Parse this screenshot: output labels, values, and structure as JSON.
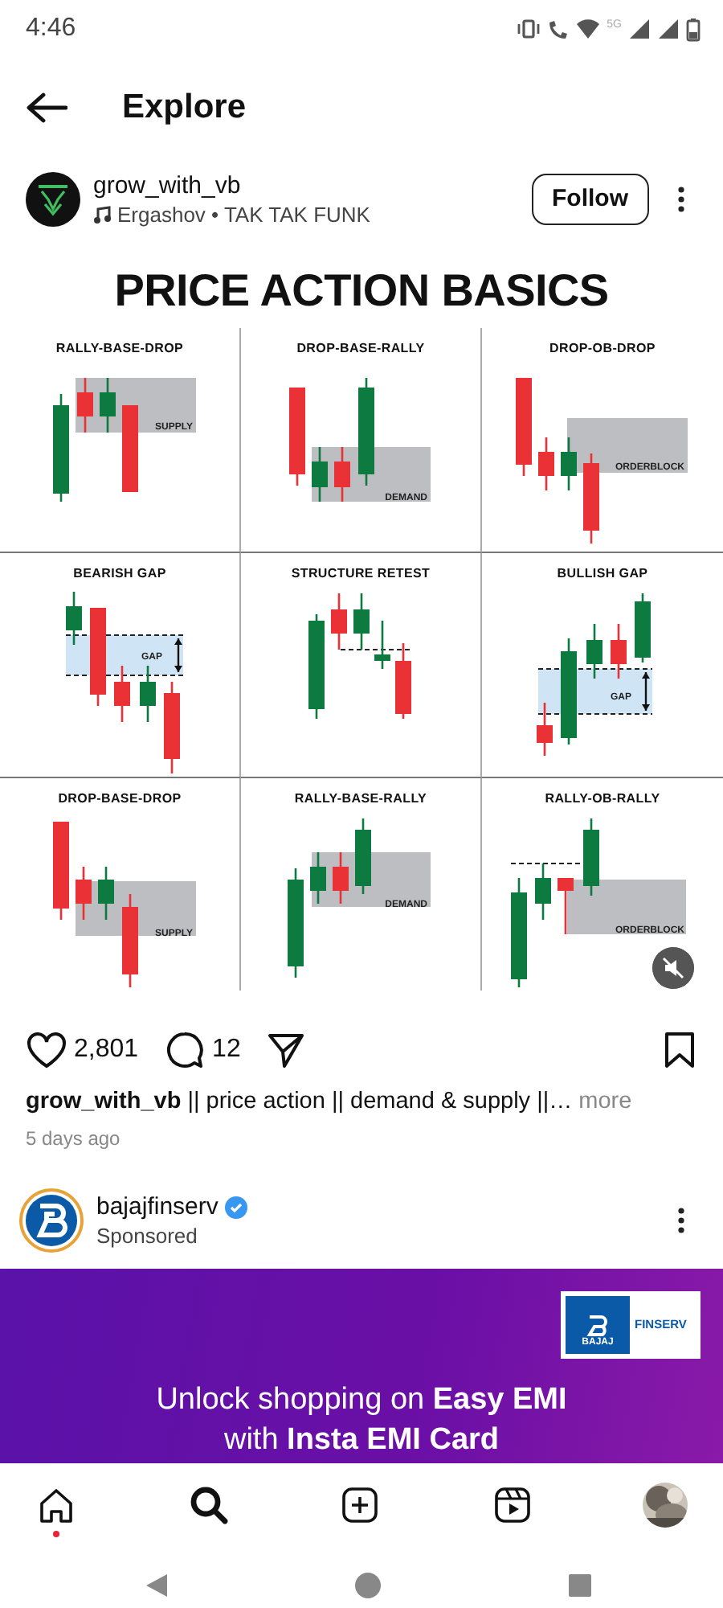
{
  "status_bar": {
    "time": "4:46",
    "network_label": "5G"
  },
  "header": {
    "title": "Explore"
  },
  "post": {
    "username": "grow_with_vb",
    "audio": "Ergashov • TAK TAK FUNK",
    "follow_label": "Follow",
    "image": {
      "title": "PRICE ACTION BASICS",
      "panels": [
        {
          "title": "RALLY-BASE-DROP",
          "zone_label": "SUPPLY"
        },
        {
          "title": "DROP-BASE-RALLY",
          "zone_label": "DEMAND"
        },
        {
          "title": "DROP-OB-DROP",
          "zone_label": "ORDERBLOCK"
        },
        {
          "title": "BEARISH GAP",
          "zone_label": "GAP"
        },
        {
          "title": "STRUCTURE RETEST"
        },
        {
          "title": "BULLISH GAP",
          "zone_label": "GAP"
        },
        {
          "title": "DROP-BASE-DROP",
          "zone_label": "SUPPLY"
        },
        {
          "title": "RALLY-BASE-RALLY",
          "zone_label": "DEMAND"
        },
        {
          "title": "RALLY-OB-RALLY",
          "zone_label": "ORDERBLOCK"
        }
      ]
    },
    "muted": true,
    "likes": "2,801",
    "comments": "12",
    "caption": "**grow_with_vb** || price action || demand & supply ||…",
    "more": "more",
    "time": "5 days ago"
  },
  "ad": {
    "username": "bajajfinserv",
    "verified": true,
    "label": "Sponsored",
    "logo_brand": "BAJAJ",
    "logo_word": "FINSERV",
    "headline": "Unlock shopping on **Easy EMI** with **Insta EMI Card**"
  },
  "nav": [
    {
      "kind": "home",
      "selected": false,
      "notification": true
    },
    {
      "kind": "search",
      "selected": true,
      "notification": false
    },
    {
      "kind": "create",
      "selected": false,
      "notification": false
    },
    {
      "kind": "reels",
      "selected": false,
      "notification": false
    },
    {
      "kind": "profile",
      "selected": false,
      "notification": false
    }
  ]
}
